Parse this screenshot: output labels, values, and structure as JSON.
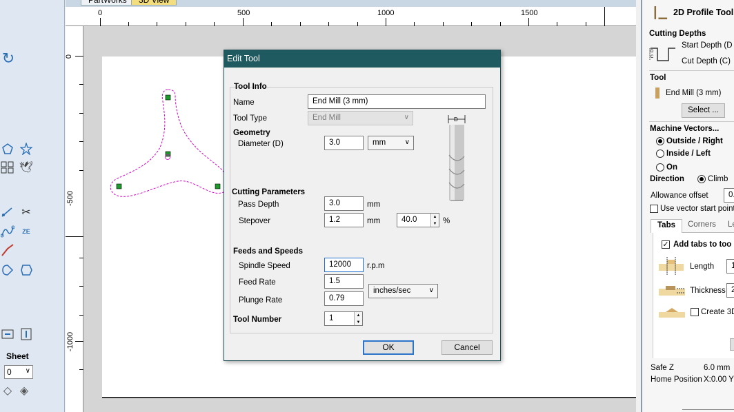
{
  "workspace_tabs": [
    "PartWorks",
    "3D View"
  ],
  "ruler": {
    "top_labels": [
      "0",
      "500",
      "1000",
      "1500"
    ],
    "left_labels": [
      "0",
      "-500",
      "-1000"
    ]
  },
  "left_toolbar": {
    "sheet_label": "Sheet",
    "sheet_value": "0"
  },
  "dialog": {
    "title": "Edit Tool",
    "section_tool_info": "Tool Info",
    "name_label": "Name",
    "name_value": "End Mill (3 mm)",
    "tool_type_label": "Tool Type",
    "tool_type_value": "End Mill",
    "section_geometry": "Geometry",
    "diameter_label": "Diameter (D)",
    "diameter_value": "3.0",
    "diameter_unit": "mm",
    "diagram_label": "D",
    "section_cutting": "Cutting Parameters",
    "pass_depth_label": "Pass Depth",
    "pass_depth_value": "3.0",
    "pass_depth_unit": "mm",
    "stepover_label": "Stepover",
    "stepover_value": "1.2",
    "stepover_unit": "mm",
    "stepover_percent_value": "40.0",
    "stepover_percent_unit": "%",
    "section_feeds": "Feeds and Speeds",
    "spindle_label": "Spindle Speed",
    "spindle_value": "12000",
    "spindle_unit": "r.p.m",
    "feed_label": "Feed Rate",
    "feed_value": "1.5",
    "feed_unit": "inches/sec",
    "plunge_label": "Plunge Rate",
    "plunge_value": "0.79",
    "tool_number_label": "Tool Number",
    "tool_number_value": "1",
    "ok_label": "OK",
    "cancel_label": "Cancel"
  },
  "right_panel": {
    "title": "2D Profile Toolp",
    "cutting_depths": "Cutting Depths",
    "start_depth": "Start Depth (D",
    "cut_depth": "Cut Depth (C)",
    "diagram_d": "D",
    "diagram_c": "C",
    "tool_heading": "Tool",
    "tool_name": "End Mill (3 mm)",
    "select_button": "Select ...",
    "machine_vectors": "Machine Vectors...",
    "outside_right": "Outside / Right",
    "inside_left": "Inside / Left",
    "on": "On",
    "direction": "Direction",
    "climb": "Climb",
    "allowance_offset": "Allowance offset",
    "allowance_value": "0.",
    "use_vector_start": "Use vector start points",
    "tabs": [
      "Tabs",
      "Corners",
      "Le"
    ],
    "add_tabs": "Add tabs to too",
    "length_label": "Length",
    "length_value": "1",
    "thickness_label": "Thickness",
    "thickness_value": "2",
    "create_3d": "Create 3D",
    "safe_z_label": "Safe Z",
    "safe_z_value": "6.0 mm",
    "home_position_label": "Home Position",
    "home_position_value": "X:0.00 Y:"
  },
  "colors": {
    "dialog_title_bg": "#1f5a61",
    "vector_dash": "#d400c8",
    "node_green": "#1d9a2b",
    "focus_blue": "#2b74c9"
  },
  "icons": [
    "undo-icon",
    "polygon-icon",
    "star-icon",
    "array-copy-icon",
    "bird-icon",
    "node-edit-icon",
    "scissors-icon",
    "curve-fit-icon",
    "text-icon",
    "spline-icon",
    "shape-icon",
    "offset-icon",
    "align-left-icon",
    "align-center-icon",
    "sheet-prev-icon",
    "sheet-next-icon"
  ]
}
